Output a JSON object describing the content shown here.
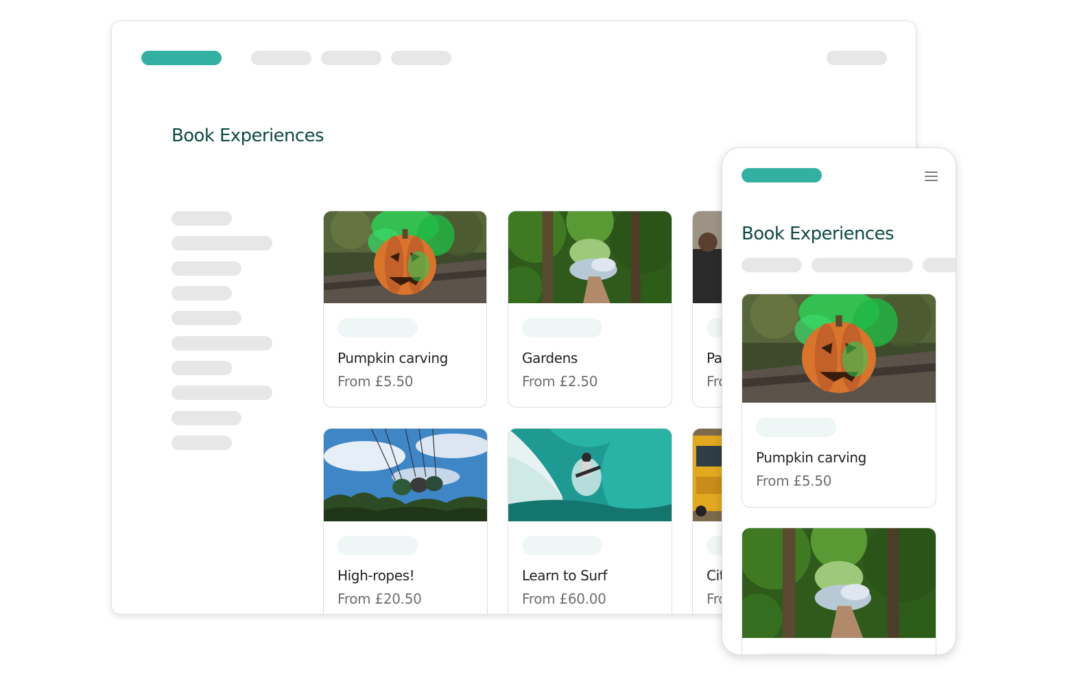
{
  "desktop": {
    "page_title": "Book Experiences",
    "cards": [
      {
        "title": "Pumpkin carving",
        "price": "From £5.50",
        "image": "pumpkin-photo"
      },
      {
        "title": "Gardens",
        "price": "From £2.50",
        "image": "garden-photo"
      },
      {
        "title": "Pa",
        "price": "Fro",
        "image": "rock-photo"
      },
      {
        "title": "High-ropes!",
        "price": "From £20.50",
        "image": "high-ropes-photo"
      },
      {
        "title": "Learn to Surf",
        "price": "From £60.00",
        "image": "surf-photo"
      },
      {
        "title": "Cit",
        "price": "Fro",
        "image": "city-bus-photo"
      }
    ]
  },
  "mobile": {
    "page_title": "Book Experiences",
    "menu_icon": "hamburger-menu-icon",
    "cards": [
      {
        "title": "Pumpkin carving",
        "price": "From £5.50",
        "image": "pumpkin-photo"
      },
      {
        "title": "",
        "price": "",
        "image": "garden-photo"
      }
    ]
  },
  "colors": {
    "accent": "#33b0a1",
    "title": "#0e4a43",
    "placeholder": "#e7e7e7",
    "tag": "#eef7f5"
  }
}
